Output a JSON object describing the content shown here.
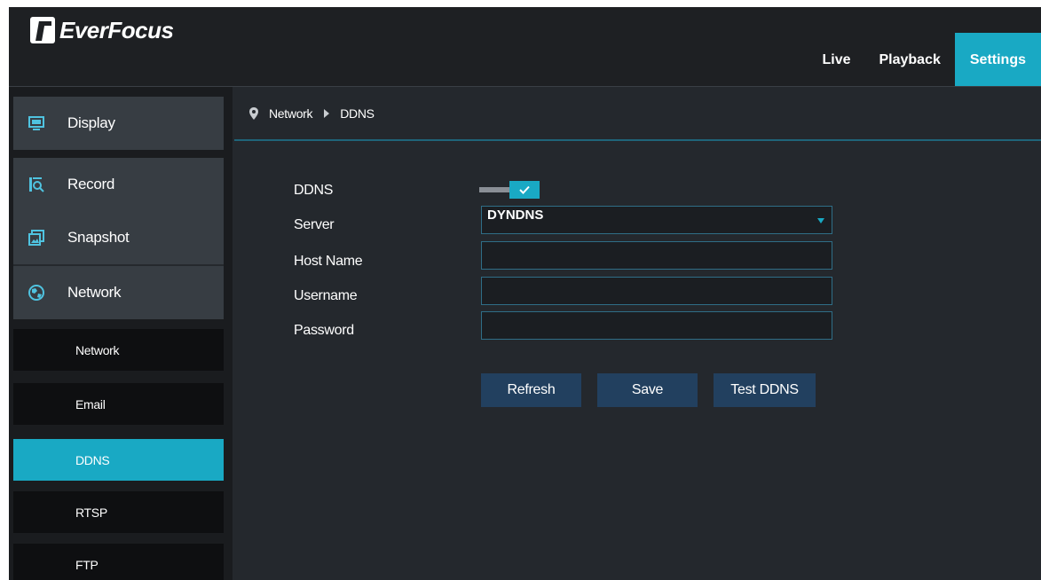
{
  "app": {
    "brand": "EverFocus"
  },
  "nav": {
    "live": "Live",
    "playback": "Playback",
    "settings": "Settings"
  },
  "sidebar": {
    "main": [
      {
        "label": "Display",
        "icon": "display-icon"
      },
      {
        "label": "Record",
        "icon": "record-search-icon"
      },
      {
        "label": "Snapshot",
        "icon": "snapshot-icon"
      },
      {
        "label": "Network",
        "icon": "network-globe-icon"
      }
    ],
    "sub": [
      {
        "label": "Network"
      },
      {
        "label": "Email"
      },
      {
        "label": "DDNS",
        "active": true
      },
      {
        "label": "RTSP"
      },
      {
        "label": "FTP"
      }
    ]
  },
  "breadcrumb": {
    "section": "Network",
    "page": "DDNS",
    "icon": "location-pin-icon"
  },
  "form": {
    "ddns_label": "DDNS",
    "ddns_enabled": true,
    "server_label": "Server",
    "server_value": "DYNDNS",
    "host_label": "Host Name",
    "host_value": "",
    "username_label": "Username",
    "username_value": "",
    "password_label": "Password",
    "password_value": ""
  },
  "buttons": {
    "refresh": "Refresh",
    "save": "Save",
    "test": "Test DDNS"
  },
  "colors": {
    "accent": "#19a9c4",
    "button": "#22405f",
    "background": "#24282d",
    "topbar": "#1e2023",
    "field_border": "#2f6e87"
  }
}
